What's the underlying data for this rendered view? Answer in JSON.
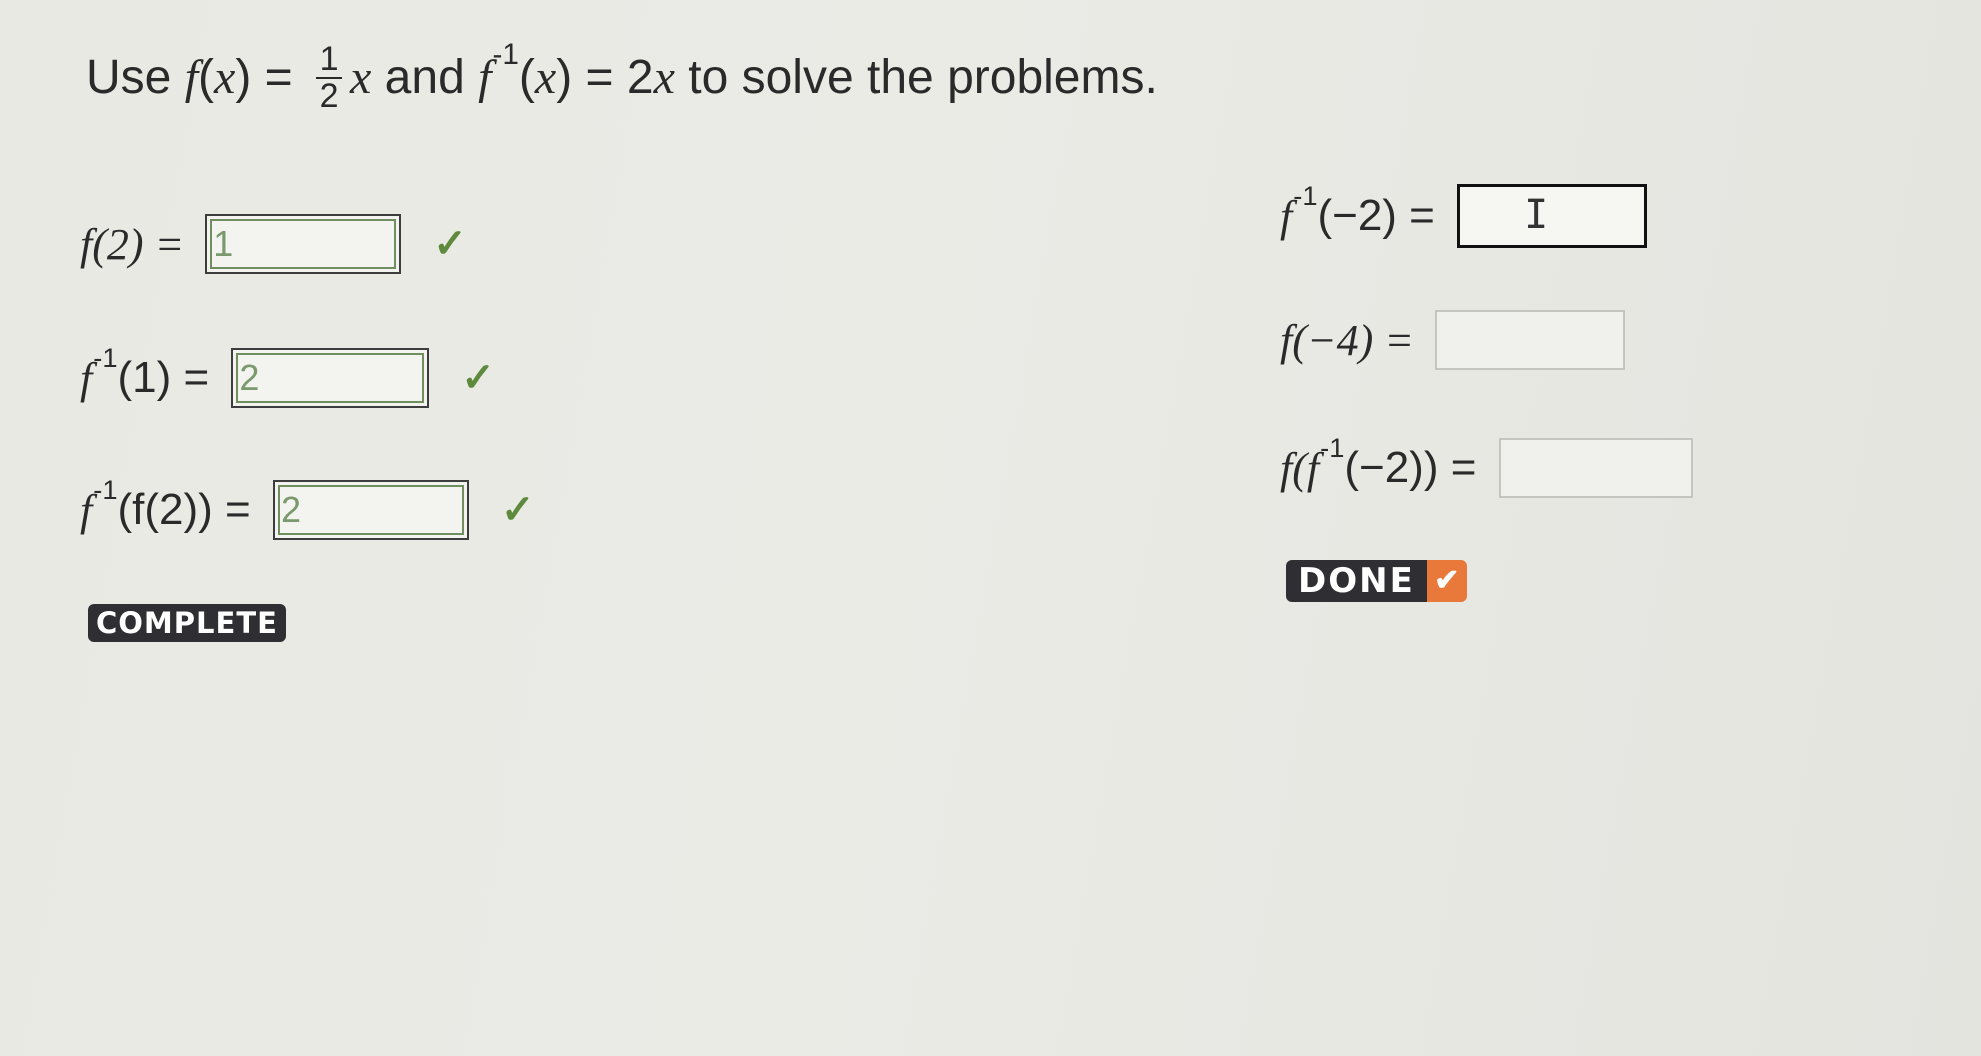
{
  "header": {
    "use": "Use",
    "f": "f",
    "x": "x",
    "paren_open": "(",
    "paren_close": ")",
    "eq": " = ",
    "frac_num": "1",
    "frac_den": "2",
    "and": " and ",
    "inv_sup": "-1",
    "two": "2",
    "rest": " to solve the problems."
  },
  "problems": [
    {
      "label_pre": "f(2) = ",
      "value": "1",
      "status": "correct"
    },
    {
      "label_f": "f",
      "label_sup": "-1",
      "label_post": "(1) = ",
      "value": "2",
      "status": "correct"
    },
    {
      "label_f": "f",
      "label_sup": "-1",
      "label_post": "(f(2)) = ",
      "value": "2",
      "status": "correct"
    },
    {
      "label_f": "f",
      "label_sup": "-1",
      "label_post": "(−2) = ",
      "value": "",
      "status": "active"
    },
    {
      "label_pre": "f(−4) = ",
      "value": "",
      "status": "blank"
    },
    {
      "label_pre": "f(f",
      "label_sup": "-1",
      "label_post": "(−2)) = ",
      "value": "",
      "status": "blank"
    }
  ],
  "check_symbol": "✓",
  "cursor_symbol": "I",
  "badge_complete": "COMPLETE",
  "done_button": {
    "label": "DONE",
    "icon": "✔"
  },
  "colors": {
    "check": "#5d8a3c",
    "done_icon_bg": "#e8793a",
    "badge_bg": "#2f2f33"
  }
}
